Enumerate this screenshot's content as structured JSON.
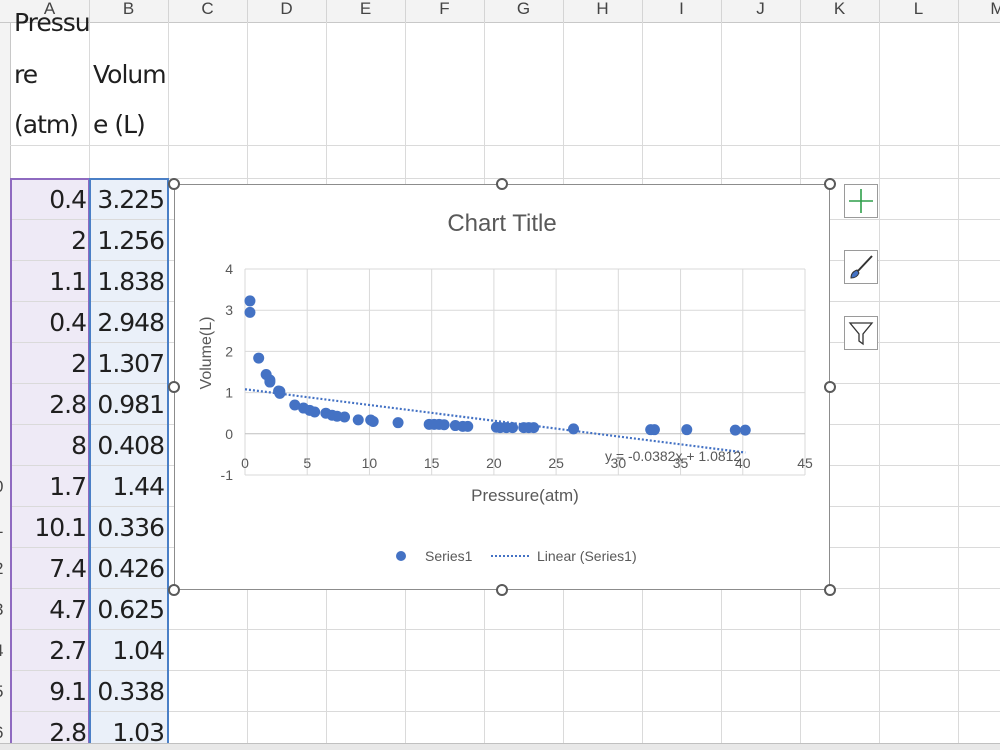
{
  "columns": [
    "A",
    "B",
    "C",
    "D",
    "E",
    "F",
    "G",
    "H",
    "I",
    "J",
    "K",
    "L",
    "M"
  ],
  "row_header_numbers": [
    "0",
    "1",
    "2",
    "3",
    "4",
    "5",
    "6"
  ],
  "header_cells": {
    "a_line1": "Pressu",
    "a_line2": "re",
    "a_line3": "(atm)",
    "b_line1": "Volum",
    "b_line2": "e (L)"
  },
  "rows": [
    {
      "a": "0.4",
      "b": "3.225"
    },
    {
      "a": "2",
      "b": "1.256"
    },
    {
      "a": "1.1",
      "b": "1.838"
    },
    {
      "a": "0.4",
      "b": "2.948"
    },
    {
      "a": "2",
      "b": "1.307"
    },
    {
      "a": "2.8",
      "b": "0.981"
    },
    {
      "a": "8",
      "b": "0.408"
    },
    {
      "a": "1.7",
      "b": "1.44"
    },
    {
      "a": "10.1",
      "b": "0.336"
    },
    {
      "a": "7.4",
      "b": "0.426"
    },
    {
      "a": "4.7",
      "b": "0.625"
    },
    {
      "a": "2.7",
      "b": "1.04"
    },
    {
      "a": "9.1",
      "b": "0.338"
    },
    {
      "a": "2.8",
      "b": "1.03"
    }
  ],
  "side_buttons": {
    "add": "chart-elements-icon",
    "style": "paintbrush-icon",
    "filter": "funnel-icon"
  },
  "colors": {
    "accent": "#4472c4",
    "plus": "#2e9e4a",
    "trend": "#4472c4"
  },
  "chart_data": {
    "type": "scatter",
    "title": "Chart Title",
    "xlabel": "Pressure(atm)",
    "ylabel": "Volume(L)",
    "xlim": [
      0,
      45
    ],
    "ylim": [
      -1,
      4
    ],
    "x_ticks": [
      "0",
      "5",
      "10",
      "15",
      "20",
      "25",
      "30",
      "35",
      "40",
      "45"
    ],
    "y_ticks": [
      "-1",
      "0",
      "1",
      "2",
      "3",
      "4"
    ],
    "grid": true,
    "legend_position": "bottom",
    "series": [
      {
        "name": "Series1",
        "points": [
          [
            0.4,
            3.225
          ],
          [
            0.4,
            2.948
          ],
          [
            1.1,
            1.838
          ],
          [
            1.7,
            1.44
          ],
          [
            2,
            1.307
          ],
          [
            2,
            1.256
          ],
          [
            2.7,
            1.04
          ],
          [
            2.8,
            1.03
          ],
          [
            2.8,
            0.981
          ],
          [
            4,
            0.7
          ],
          [
            4.7,
            0.625
          ],
          [
            5.2,
            0.57
          ],
          [
            5.6,
            0.53
          ],
          [
            6.5,
            0.5
          ],
          [
            7,
            0.45
          ],
          [
            7.4,
            0.426
          ],
          [
            8,
            0.408
          ],
          [
            9.1,
            0.338
          ],
          [
            10.1,
            0.336
          ],
          [
            10.3,
            0.3
          ],
          [
            12.3,
            0.27
          ],
          [
            14.8,
            0.23
          ],
          [
            15.2,
            0.23
          ],
          [
            15.6,
            0.23
          ],
          [
            16,
            0.22
          ],
          [
            16.9,
            0.2
          ],
          [
            17.5,
            0.18
          ],
          [
            17.9,
            0.18
          ],
          [
            20.2,
            0.16
          ],
          [
            20.5,
            0.15
          ],
          [
            21,
            0.15
          ],
          [
            21.5,
            0.15
          ],
          [
            22.4,
            0.15
          ],
          [
            22.8,
            0.15
          ],
          [
            23.2,
            0.15
          ],
          [
            26.4,
            0.12
          ],
          [
            32.6,
            0.1
          ],
          [
            32.9,
            0.1
          ],
          [
            35.5,
            0.1
          ],
          [
            39.4,
            0.09
          ],
          [
            40.2,
            0.09
          ]
        ]
      }
    ],
    "trendline": {
      "name": "Linear (Series1)",
      "type": "linear",
      "slope": -0.0382,
      "intercept": 1.0812,
      "x_range": [
        0,
        40.2
      ],
      "equation": "y = -0.0382x + 1.0812"
    }
  }
}
